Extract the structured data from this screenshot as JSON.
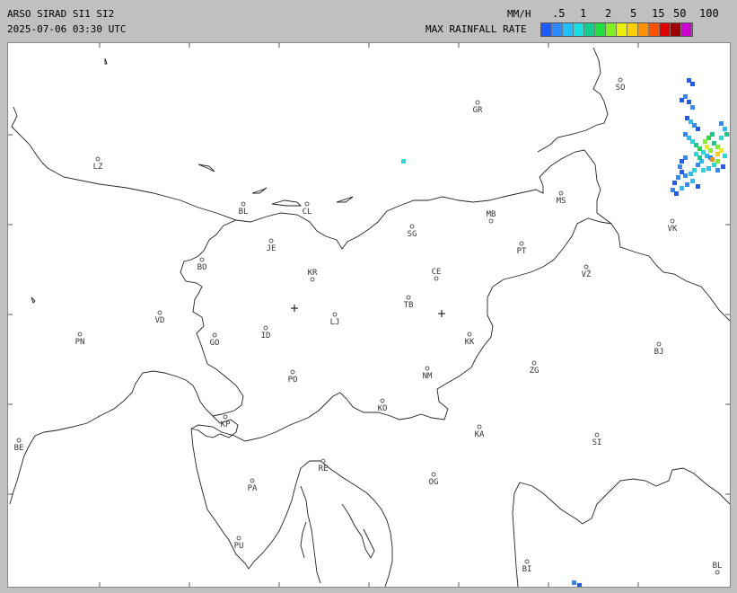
{
  "header": {
    "title": "ARSO SIRAD SI1 SI2",
    "timestamp": "2025-07-06 03:30 UTC",
    "units": "MM/H",
    "legend_title": "MAX RAINFALL RATE"
  },
  "legend": {
    "ticks": [
      ".5",
      "1",
      "2",
      "5",
      "15",
      "50",
      "100"
    ],
    "colors": [
      "#1c5cff",
      "#2a8cff",
      "#1fc0ff",
      "#18e0e0",
      "#10d090",
      "#20e040",
      "#80f020",
      "#e8f000",
      "#ffd000",
      "#ff9000",
      "#ff5000",
      "#e00000",
      "#a00000",
      "#d000d0"
    ]
  },
  "cities": [
    {
      "code": "GR"
    },
    {
      "code": "SO"
    },
    {
      "code": "LZ"
    },
    {
      "code": "BL"
    },
    {
      "code": "CL"
    },
    {
      "code": "MS"
    },
    {
      "code": "MB"
    },
    {
      "code": "SG"
    },
    {
      "code": "VK"
    },
    {
      "code": "JE"
    },
    {
      "code": "PT"
    },
    {
      "code": "BO"
    },
    {
      "code": "KR"
    },
    {
      "code": "CE"
    },
    {
      "code": "VŽ"
    },
    {
      "code": "TB"
    },
    {
      "code": "VD"
    },
    {
      "code": "LJ"
    },
    {
      "code": "PN"
    },
    {
      "code": "ID"
    },
    {
      "code": "GO"
    },
    {
      "code": "KK"
    },
    {
      "code": "BJ"
    },
    {
      "code": "ZG"
    },
    {
      "code": "PO"
    },
    {
      "code": "NM"
    },
    {
      "code": "KO"
    },
    {
      "code": "KP"
    },
    {
      "code": "KA"
    },
    {
      "code": "BE"
    },
    {
      "code": "SI"
    },
    {
      "code": "RE"
    },
    {
      "code": "PA"
    },
    {
      "code": "OG"
    },
    {
      "code": "PU"
    },
    {
      "code": "BI"
    },
    {
      "code": "BL"
    }
  ],
  "radar_sites": [
    {
      "name": "radar-site-lisca"
    },
    {
      "name": "radar-site-pasja-ravan"
    }
  ]
}
